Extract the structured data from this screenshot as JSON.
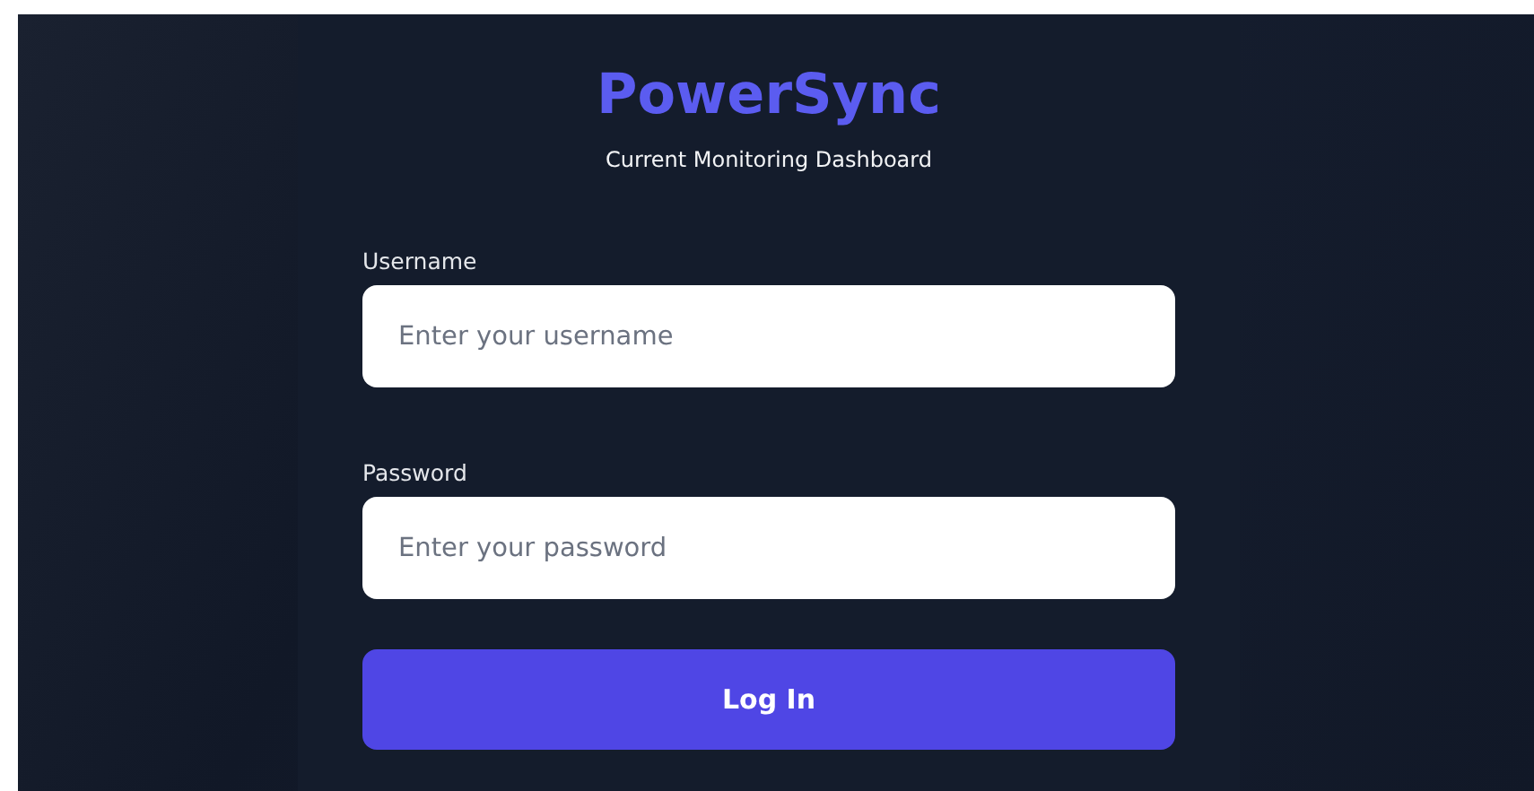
{
  "brand": {
    "title": "PowerSync",
    "subtitle": "Current Monitoring Dashboard"
  },
  "fields": [
    {
      "label": "Username",
      "placeholder": "Enter your username"
    },
    {
      "label": "Password",
      "placeholder": "Enter your password"
    }
  ],
  "button": "Log In"
}
